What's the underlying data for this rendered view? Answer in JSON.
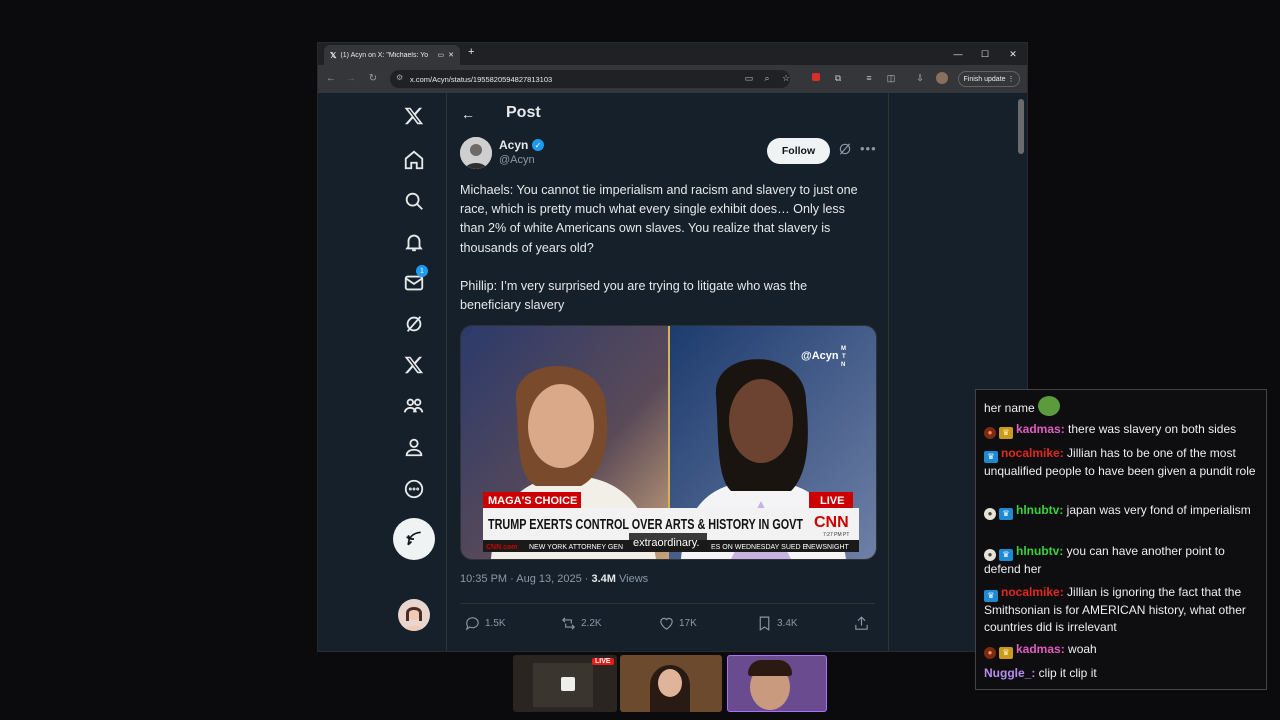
{
  "browser": {
    "tab_title": "(1) Acyn on X: \"Michaels: Yo",
    "url": "x.com/Acyn/status/1955820594827813103",
    "finish_update": "Finish update",
    "new_tab": "+"
  },
  "post": {
    "header_title": "Post",
    "author_name": "Acyn",
    "author_handle": "@Acyn",
    "follow_label": "Follow",
    "paragraph_1": "Michaels: You cannot tie imperialism and racism and slavery to just one race, which is pretty much what every single exhibit does… Only less than 2% of white Americans own slaves. You realize that slavery is thousands of years old?",
    "paragraph_2": "Phillip: I’m very surprised you are trying to litigate who was the beneficiary slavery",
    "media": {
      "watermark": "@Acyn",
      "mtn": "M\nT\nN",
      "tag_left": "MAGA'S CHOICE",
      "tag_live": "LIVE",
      "headline": "TRUMP EXERTS CONTROL OVER ARTS & HISTORY IN GOVT",
      "cnn": "CNN",
      "time": "7:27 PM PT",
      "ticker_brand": "CNN.com",
      "ticker": "NEW YORK ATTORNEY GEN",
      "ticker_2": "ES ON WEDNESDAY SUED E",
      "newsnight": "NEWSNIGHT",
      "caption": "extraordinary."
    },
    "timestamp": "10:35 PM · Aug 13, 2025 · ",
    "views_count": "3.4M",
    "views_label": " Views",
    "actions": {
      "replies": "1.5K",
      "reposts": "2.2K",
      "likes": "17K",
      "bookmarks": "3.4K"
    },
    "notification_badge": "1"
  },
  "chat": {
    "messages": [
      {
        "user": "",
        "text": "her name"
      },
      {
        "user": "kadmas:",
        "text": " there was slavery on both sides",
        "color": "#e05cc0"
      },
      {
        "user": "nocalmike:",
        "text": " Jillian has to be one of the most unqualified people to have been given a pundit role",
        "color": "#e0291d"
      },
      {
        "user": "hlnubtv:",
        "text": " japan was very fond of imperialism",
        "color": "#3bd13b"
      },
      {
        "user": "hlnubtv:",
        "text": " you can have another point to defend her",
        "color": "#3bd13b"
      },
      {
        "user": "nocalmike:",
        "text": " Jillian is ignoring the fact that the Smithsonian is for AMERICAN history, what other countries did is irrelevant",
        "color": "#e0291d"
      },
      {
        "user": "kadmas:",
        "text": " woah",
        "color": "#e05cc0"
      },
      {
        "user": "Nuggle_:",
        "text": " clip it clip it",
        "color": "#b58cf0"
      }
    ]
  },
  "thumbnails": {
    "live_label": "LIVE"
  }
}
